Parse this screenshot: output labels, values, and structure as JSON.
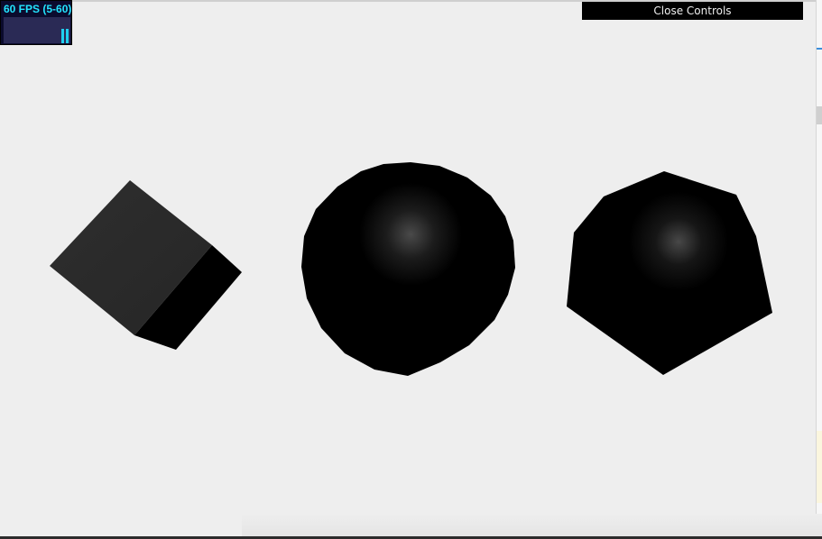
{
  "stats": {
    "fps_label": "60 FPS (5-60)",
    "bar_levels": [
      0.55,
      0.55
    ]
  },
  "controls": {
    "close_label": "Close Controls"
  },
  "colors": {
    "background": "#eeeeee",
    "stats_text": "#23e5ff",
    "stats_bg": "#0b0b2e",
    "controls_bg": "#000000",
    "shape_fill": "#000000",
    "highlight": "#4a4a4a"
  },
  "scene": {
    "objects": [
      "cube",
      "sphere",
      "icosahedron"
    ]
  }
}
